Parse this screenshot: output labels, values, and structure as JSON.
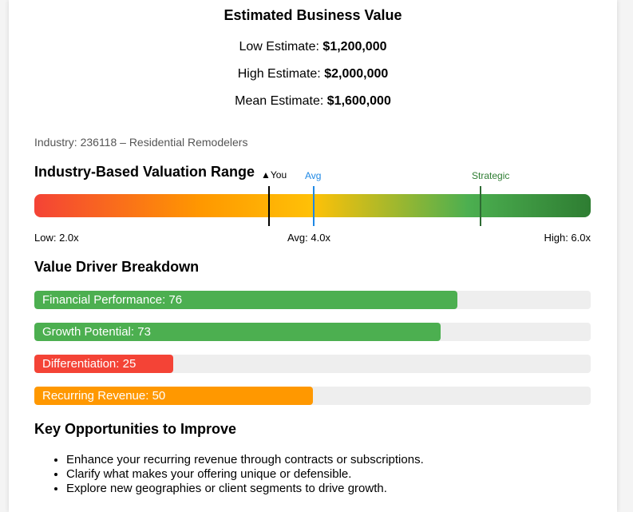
{
  "summary": {
    "title": "Estimated Business Value",
    "low_label": "Low Estimate:",
    "low_value": "$1,200,000",
    "high_label": "High Estimate:",
    "high_value": "$2,000,000",
    "mean_label": "Mean Estimate:",
    "mean_value": "$1,600,000"
  },
  "industry": "Industry: 236118 – Residential Remodelers",
  "valuation_range": {
    "heading": "Industry-Based Valuation Range",
    "markers": {
      "you_label": "▲You",
      "avg_label": "Avg",
      "strategic_label": "Strategic"
    },
    "scale": {
      "low": "Low: 2.0x",
      "avg": "Avg: 4.0x",
      "high": "High: 6.0x"
    },
    "colors": {
      "you": "#000000",
      "avg": "#1e88e5",
      "strategic": "#2e7d32"
    }
  },
  "value_drivers": {
    "heading": "Value Driver Breakdown",
    "items": [
      {
        "label": "Financial Performance: 76",
        "score": 76,
        "color": "#4caf50"
      },
      {
        "label": "Growth Potential: 73",
        "score": 73,
        "color": "#4caf50"
      },
      {
        "label": "Differentiation: 25",
        "score": 25,
        "color": "#f44336"
      },
      {
        "label": "Recurring Revenue: 50",
        "score": 50,
        "color": "#ff9800"
      }
    ]
  },
  "opportunities": {
    "heading": "Key Opportunities to Improve",
    "items": [
      "Enhance your recurring revenue through contracts or subscriptions.",
      "Clarify what makes your offering unique or defensible.",
      "Explore new geographies or client segments to drive growth."
    ]
  }
}
